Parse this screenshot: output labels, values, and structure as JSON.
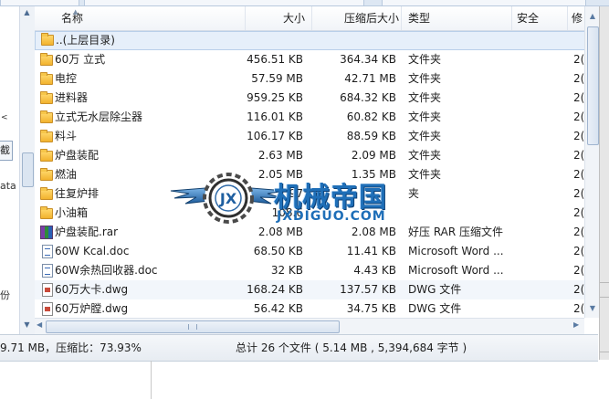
{
  "left_panel": {
    "fragments": [
      "截",
      "ata",
      "份"
    ]
  },
  "columns": {
    "name": "名称",
    "size": "大小",
    "compressed": "压缩后大小",
    "type": "类型",
    "security": "安全",
    "modified": "修"
  },
  "files": [
    {
      "icon": "folder",
      "name": "..(上层目录)",
      "size": "",
      "compressed": "",
      "type": "",
      "mod": ""
    },
    {
      "icon": "folder",
      "name": "60万 立式",
      "size": "456.51 KB",
      "compressed": "364.34 KB",
      "type": "文件夹",
      "mod": "2("
    },
    {
      "icon": "folder",
      "name": "电控",
      "size": "57.59 MB",
      "compressed": "42.71 MB",
      "type": "文件夹",
      "mod": "2("
    },
    {
      "icon": "folder",
      "name": "进料器",
      "size": "959.25 KB",
      "compressed": "684.32 KB",
      "type": "文件夹",
      "mod": "2("
    },
    {
      "icon": "folder",
      "name": "立式无水层除尘器",
      "size": "116.01 KB",
      "compressed": "60.82 KB",
      "type": "文件夹",
      "mod": "2("
    },
    {
      "icon": "folder",
      "name": "料斗",
      "size": "106.17 KB",
      "compressed": "88.59 KB",
      "type": "文件夹",
      "mod": "2("
    },
    {
      "icon": "folder",
      "name": "炉盘装配",
      "size": "2.63 MB",
      "compressed": "2.09 MB",
      "type": "文件夹",
      "mod": "2("
    },
    {
      "icon": "folder",
      "name": "燃油",
      "size": "2.05 MB",
      "compressed": "1.35 MB",
      "type": "文件夹",
      "mod": "2("
    },
    {
      "icon": "folder",
      "name": "往复炉排",
      "size": "97",
      "compressed": "",
      "type": "夹",
      "mod": "2("
    },
    {
      "icon": "folder",
      "name": "小油箱",
      "size": "108.6",
      "compressed": "",
      "type": "",
      "mod": "2("
    },
    {
      "icon": "rar",
      "name": "炉盘装配.rar",
      "size": "2.08 MB",
      "compressed": "2.08 MB",
      "type": "好压 RAR 压缩文件",
      "mod": "2("
    },
    {
      "icon": "doc",
      "name": "60W Kcal.doc",
      "size": "68.50 KB",
      "compressed": "11.41 KB",
      "type": "Microsoft Word ...",
      "mod": "2("
    },
    {
      "icon": "doc",
      "name": "60W余热回收器.doc",
      "size": "32 KB",
      "compressed": "4.43 KB",
      "type": "Microsoft Word ...",
      "mod": "2("
    },
    {
      "icon": "dwg",
      "name": "60万大卡.dwg",
      "size": "168.24 KB",
      "compressed": "137.57 KB",
      "type": "DWG 文件",
      "mod": "2("
    },
    {
      "icon": "dwg",
      "name": "60万炉膛.dwg",
      "size": "56.42 KB",
      "compressed": "34.75 KB",
      "type": "DWG 文件",
      "mod": "2("
    }
  ],
  "status": {
    "left": "9.71 MB，压缩比：73.93%",
    "right": "总计 26 个文件 ( 5.14 MB , 5,394,684 字节 )"
  },
  "watermark": {
    "title": "机械帝国",
    "subtitle": "JXDIGUO.COM",
    "emblem": "JX"
  },
  "colors": {
    "accent": "#1f6fb8",
    "selection": "#e6effa",
    "folder": "#f2b22e"
  }
}
